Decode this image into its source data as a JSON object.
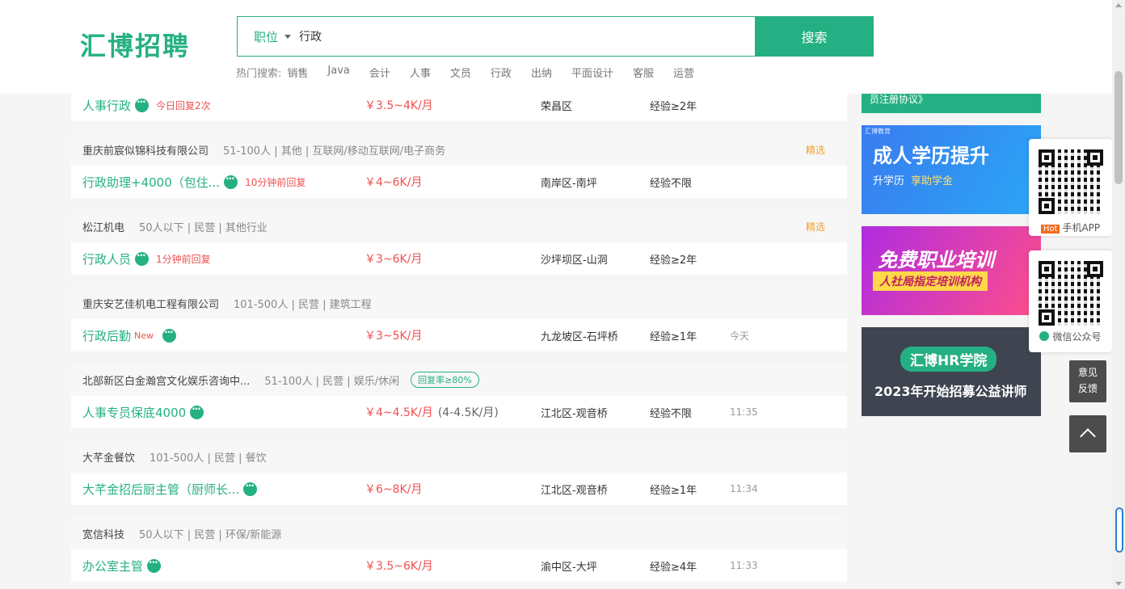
{
  "header": {
    "logo": "汇博招聘",
    "search_type": "职位",
    "search_value": "行政",
    "search_button": "搜索",
    "hot_label": "热门搜索:",
    "hot_words": [
      "销售",
      "Java",
      "会计",
      "人事",
      "文员",
      "行政",
      "出纳",
      "平面设计",
      "客服",
      "运营"
    ]
  },
  "jobs": [
    {
      "title": "人事行政",
      "reply": "今日回复2次",
      "salary": "￥3.5~4K/月",
      "location": "荣昌区",
      "experience": "经验≥2年"
    },
    {
      "company": "重庆前宸似锦科技有限公司",
      "meta": "51-100人 | 其他 | 互联网/移动互联网/电子商务",
      "pick": "精选",
      "title": "行政助理+4000（包住...",
      "reply": "10分钟前回复",
      "salary": "￥4~6K/月",
      "location": "南岸区-南坪",
      "experience": "经验不限"
    },
    {
      "company": "松江机电",
      "meta": "50人以下 | 民营 | 其他行业",
      "pick": "精选",
      "title": "行政人员",
      "reply": "1分钟前回复",
      "salary": "￥3~6K/月",
      "location": "沙坪坝区-山洞",
      "experience": "经验≥2年"
    },
    {
      "company": "重庆安艺佳机电工程有限公司",
      "meta": "101-500人 | 民营 | 建筑工程",
      "title": "行政后勤",
      "new": "New",
      "salary": "￥3~5K/月",
      "location": "九龙坡区-石坪桥",
      "experience": "经验≥1年",
      "time": "今天"
    },
    {
      "company": "北部新区白金瀚宫文化娱乐咨询中...",
      "meta": "51-100人 | 民营 | 娱乐/休闲",
      "rate": "回复率≥80%",
      "title": "人事专员保底4000",
      "salary": "￥4~4.5K/月",
      "salary_alt": "(4-4.5K/月)",
      "location": "江北区-观音桥",
      "experience": "经验不限",
      "time": "11:35"
    },
    {
      "company": "大芊金餐饮",
      "meta": "101-500人 | 民营 | 餐饮",
      "title": "大芊金招后厨主管（厨师长...",
      "salary": "￥6~8K/月",
      "location": "江北区-观音桥",
      "experience": "经验≥1年",
      "time": "11:34"
    },
    {
      "company": "宽信科技",
      "meta": "50人以下 | 民营 | 环保/新能源",
      "title": "办公室主管",
      "salary": "￥3.5~6K/月",
      "location": "渝中区-大坪",
      "experience": "经验≥4年",
      "time": "11:33"
    }
  ],
  "sidebar": {
    "register_text": "员注册协议》",
    "banner1": {
      "tag": "汇博教育",
      "title": "成人学历提升",
      "sub1": "升学历",
      "sub2": "享助学金"
    },
    "banner2": {
      "title": "免费职业培训",
      "sub": "人社局指定培训机构"
    },
    "banner3": {
      "title": "汇博HR学院",
      "sub": "2023年开始招募公益讲师"
    },
    "qr_app_badge": "Hot",
    "qr_app_label": "手机APP",
    "qr_wx_label": "微信公众号",
    "feedback_line1": "意见",
    "feedback_line2": "反馈"
  }
}
